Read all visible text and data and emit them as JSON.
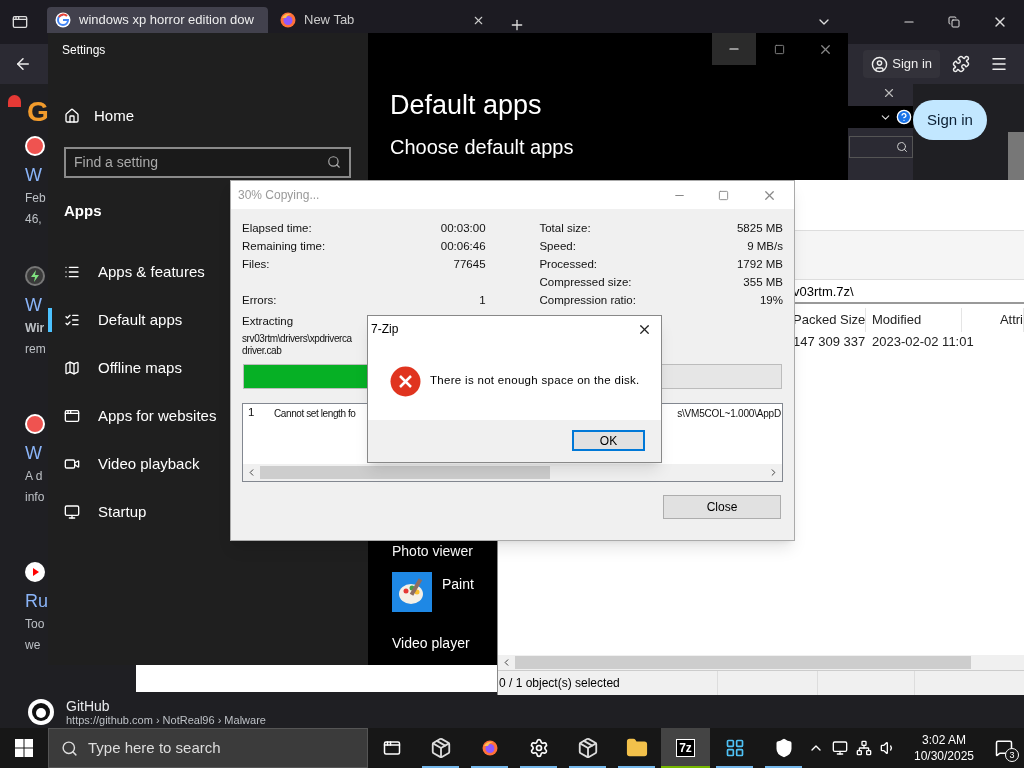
{
  "browser": {
    "tabs": [
      {
        "title": "windows xp horror edition dow",
        "selected": true
      },
      {
        "title": "New Tab",
        "selected": false
      }
    ],
    "sign_in": "Sign in",
    "page": {
      "logo": "G",
      "sign_in": "Sign in",
      "results": [
        {
          "kind": "app",
          "title": "W",
          "snippet": [
            {
              "text": "Feb",
              "bold": false
            },
            {
              "text": "46,",
              "bold": false
            }
          ]
        },
        {
          "kind": "bolt",
          "title": "W",
          "snippet": [
            {
              "text": "Wir",
              "bold": true
            },
            {
              "text": "rem",
              "bold": false
            }
          ]
        },
        {
          "kind": "app",
          "title": "W",
          "snippet": [
            {
              "text": "A d",
              "bold": false
            },
            {
              "text": "info",
              "bold": false
            }
          ]
        },
        {
          "kind": "video",
          "title": "Ru",
          "snippet": [
            {
              "text": "Too",
              "bold": false
            },
            {
              "text": "we",
              "bold": false
            }
          ]
        }
      ],
      "github": {
        "site": "GitHub",
        "url": "https://github.com › NotReal96 › Malware"
      }
    }
  },
  "settings": {
    "title": "Settings",
    "home": "Home",
    "search_placeholder": "Find a setting",
    "section": "Apps",
    "nav": [
      {
        "label": "Apps & features",
        "selected": false
      },
      {
        "label": "Default apps",
        "selected": true
      },
      {
        "label": "Offline maps",
        "selected": false
      },
      {
        "label": "Apps for websites",
        "selected": false
      },
      {
        "label": "Video playback",
        "selected": false
      },
      {
        "label": "Startup",
        "selected": false
      }
    ],
    "heading": "Default apps",
    "subheading": "Choose default apps",
    "defaults": [
      {
        "kind": "category",
        "text": "Photo viewer"
      },
      {
        "kind": "app",
        "text": "Paint"
      },
      {
        "kind": "category",
        "text": "Video player"
      }
    ]
  },
  "file_manager": {
    "path": "v03rtm.7z\\",
    "columns": [
      "Packed Size",
      "Modified",
      "Attri"
    ],
    "rows": [
      {
        "packed_size": "147 309 337",
        "modified": "2023-02-02 11:01"
      }
    ],
    "status": "0 / 1 object(s) selected"
  },
  "progress_dialog": {
    "title": "30% Copying...",
    "left_stats": [
      {
        "label": "Elapsed time:",
        "value": "00:03:00"
      },
      {
        "label": "Remaining time:",
        "value": "00:06:46"
      },
      {
        "label": "Files:",
        "value": "77645"
      }
    ],
    "errors": {
      "label": "Errors:",
      "value": "1"
    },
    "right_stats": [
      {
        "label": "Total size:",
        "value": "5825 MB"
      },
      {
        "label": "Speed:",
        "value": "9 MB/s"
      },
      {
        "label": "Processed:",
        "value": "1792 MB"
      },
      {
        "label": "Compressed size:",
        "value": "355 MB"
      },
      {
        "label": "Compression ratio:",
        "value": "19%"
      }
    ],
    "status": "Extracting",
    "current_file": [
      "srv03rtm\\drivers\\xpdriverca",
      "driver.cab"
    ],
    "progress": {
      "level": 0.3
    },
    "log": [
      {
        "index": "1",
        "text": "Cannot set length fo",
        "tail": "s\\VM5COL~1.000\\AppD"
      }
    ],
    "close": "Close"
  },
  "message_box": {
    "title": "7-Zip",
    "message": "There is not enough space on the disk.",
    "ok": "OK"
  },
  "taskbar": {
    "search_placeholder": "Type here to search",
    "apps": [
      {
        "kind": "package",
        "active": false
      },
      {
        "kind": "browser",
        "active": false
      },
      {
        "kind": "gear",
        "active": false
      },
      {
        "kind": "package",
        "active": false
      },
      {
        "kind": "folder",
        "active": false
      },
      {
        "kind": "archiver",
        "label": "7z",
        "active": true
      },
      {
        "kind": "panel",
        "active": false
      },
      {
        "kind": "shield",
        "active": false
      }
    ],
    "time": "3:02 AM",
    "date": "10/30/2025",
    "notifications": "3"
  }
}
